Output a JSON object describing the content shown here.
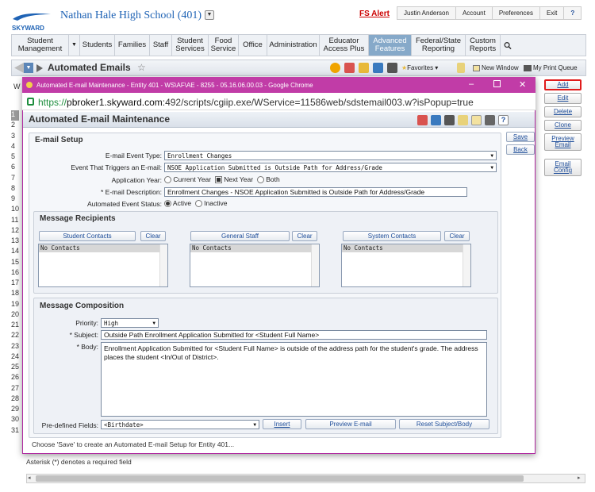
{
  "app": {
    "school_name": "Nathan Hale High School (401)",
    "logo_text": "SKYWARD",
    "alert_link": "FS Alert",
    "user_links": [
      "Justin Anderson",
      "Account",
      "Preferences",
      "Exit",
      "?"
    ]
  },
  "nav": [
    {
      "label": "Student Management"
    },
    {
      "label": "Students"
    },
    {
      "label": "Families"
    },
    {
      "label": "Staff"
    },
    {
      "label": "Student Services"
    },
    {
      "label": "Food Service"
    },
    {
      "label": "Office"
    },
    {
      "label": "Administration"
    },
    {
      "label": "Educator Access Plus"
    },
    {
      "label": "Advanced Features",
      "active": true
    },
    {
      "label": "Federal/State Reporting"
    },
    {
      "label": "Custom Reports"
    }
  ],
  "toolbar": {
    "title": "Automated Emails",
    "favorites": "Favorites",
    "new_window": "New Window",
    "print_queue": "My Print Queue"
  },
  "side_buttons": [
    "Add",
    "Edit",
    "Delete",
    "Clone",
    "Preview Email",
    "Email Config"
  ],
  "row_numbers": [
    "1",
    "2",
    "3",
    "4",
    "5",
    "6",
    "7",
    "8",
    "9",
    "10",
    "11",
    "12",
    "13",
    "14",
    "15",
    "16",
    "17",
    "18",
    "19",
    "20",
    "21",
    "22",
    "23",
    "24",
    "25",
    "26",
    "27",
    "28",
    "29",
    "30",
    "31"
  ],
  "bottom_note": "Asterisk (*) denotes a required field",
  "popup": {
    "window_title": "Automated E-mail Maintenance - Entity 401 - WS\\AF\\AE - 8255 - 05.16.06.00.03 - Google Chrome",
    "url_scheme": "https://",
    "url_host": "pbroker1.skyward.com",
    "url_path": ":492/scripts/cgiip.exe/WService=11586web/sdstemail003.w?isPopup=true",
    "heading": "Automated E-mail Maintenance",
    "help": "?",
    "save": "Save",
    "back": "Back",
    "setup": {
      "title": "E-mail Setup",
      "event_type_label": "E-mail Event Type:",
      "event_type_value": "Enrollment Changes",
      "trigger_label": "Event That Triggers an E-mail:",
      "trigger_value": "NSOE Application Submitted is Outside Path for Address/Grade",
      "app_year_label": "Application Year:",
      "app_year_options": [
        "Current Year",
        "Next Year",
        "Both"
      ],
      "app_year_selected": "Next Year",
      "description_label": "* E-mail Description:",
      "description_value": "Enrollment Changes - NSOE Application Submitted is Outside Path for Address/Grade",
      "status_label": "Automated Event Status:",
      "status_options": [
        "Active",
        "Inactive"
      ],
      "status_selected": "Active"
    },
    "recipients": {
      "title": "Message Recipients",
      "clear": "Clear",
      "lists": [
        {
          "button": "Student Contacts",
          "item": "No Contacts"
        },
        {
          "button": "General Staff",
          "item": "No Contacts"
        },
        {
          "button": "System Contacts",
          "item": "No Contacts"
        }
      ]
    },
    "composition": {
      "title": "Message Composition",
      "priority_label": "Priority:",
      "priority_value": "High",
      "subject_label": "* Subject:",
      "subject_value": "Outside Path Enrollment Application Submitted for <Student Full Name>",
      "body_label": "* Body:",
      "body_value": "Enrollment Application Submitted for <Student Full Name> is outside of the address path for the student's grade.  The address places the student <In/Out of District>.",
      "fields_label": "Pre-defined Fields:",
      "fields_value": "<Birthdate>",
      "insert": "Insert",
      "preview": "Preview E-mail",
      "reset": "Reset Subject/Body"
    },
    "footer": "Choose 'Save' to create an Automated E-mail Setup for Entity 401..."
  },
  "colors": {
    "accent": "#c13ca7",
    "brand": "#1f63b5",
    "active_nav": "#86a9c9",
    "alert": "#cc0000"
  }
}
